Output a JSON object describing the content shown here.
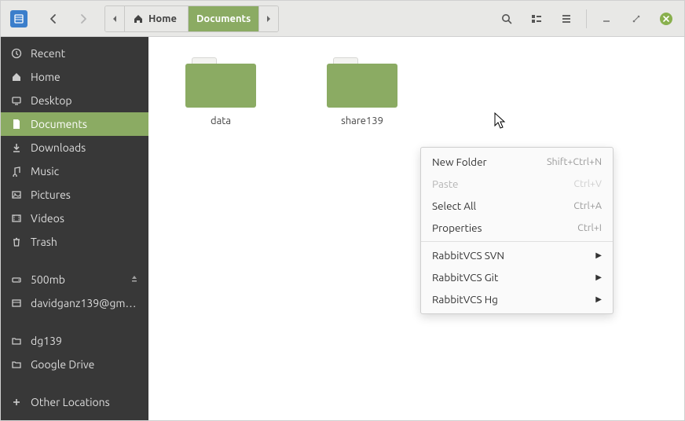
{
  "pathbar": {
    "home": "Home",
    "documents": "Documents"
  },
  "sidebar": {
    "recent": "Recent",
    "home": "Home",
    "desktop": "Desktop",
    "documents": "Documents",
    "downloads": "Downloads",
    "music": "Music",
    "pictures": "Pictures",
    "videos": "Videos",
    "trash": "Trash",
    "vol1": "500mb",
    "gmail": "davidganz139@gm…",
    "dg139": "dg139",
    "gdrive": "Google Drive",
    "other": "Other Locations"
  },
  "folders": {
    "items": [
      {
        "label": "data"
      },
      {
        "label": "share139"
      }
    ]
  },
  "menu": {
    "new_folder": "New Folder",
    "new_folder_sc": "Shift+Ctrl+N",
    "paste": "Paste",
    "paste_sc": "Ctrl+V",
    "select_all": "Select All",
    "select_all_sc": "Ctrl+A",
    "properties": "Properties",
    "properties_sc": "Ctrl+I",
    "rvcs_svn": "RabbitVCS SVN",
    "rvcs_git": "RabbitVCS Git",
    "rvcs_hg": "RabbitVCS Hg"
  }
}
